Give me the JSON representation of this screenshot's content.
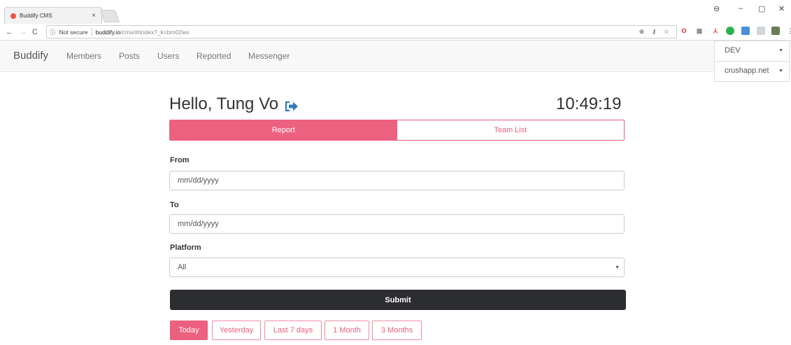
{
  "browser": {
    "tab_title": "Buddify CMS",
    "tab_close": "×",
    "security_label": "Not secure",
    "url_host": "buddify.io",
    "url_path": "/cms/#/index?_k=bm02ws",
    "window_controls": {
      "minimize": "–",
      "restore": "▢",
      "close": "✕"
    }
  },
  "navbar": {
    "brand": "Buddify",
    "links": [
      "Members",
      "Posts",
      "Users",
      "Reported",
      "Messenger"
    ],
    "env_select": "DEV",
    "site_select": "crushapp.net"
  },
  "header": {
    "greeting": "Hello, Tung Vo",
    "clock": "10:49:19"
  },
  "tabs": {
    "report": "Report",
    "team_list": "Team List"
  },
  "form": {
    "from_label": "From",
    "from_placeholder": "mm/dd/yyyy",
    "to_label": "To",
    "to_placeholder": "mm/dd/yyyy",
    "platform_label": "Platform",
    "platform_value": "All",
    "submit": "Submit"
  },
  "quick_ranges": [
    "Today",
    "Yesterday",
    "Last 7 days",
    "1 Month",
    "3 Months"
  ],
  "colors": {
    "accent": "#ec6080",
    "dark": "#2c2d31",
    "icon_blue": "#337ab7"
  }
}
